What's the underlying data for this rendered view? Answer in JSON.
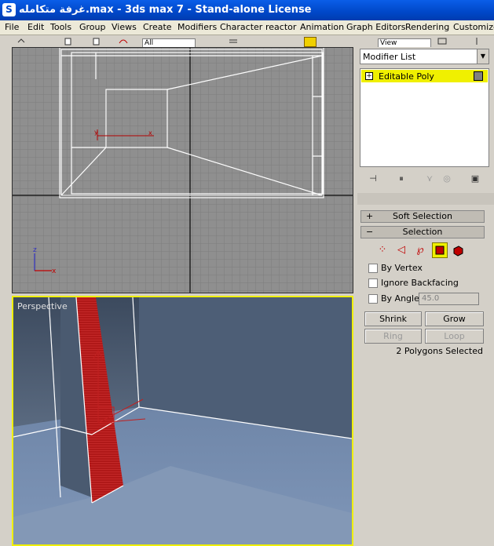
{
  "window": {
    "title": "غرفة متكامله.max - 3ds max 7  - Stand-alone License",
    "app_icon_glyph": "S"
  },
  "menu": [
    "File",
    "Edit",
    "Tools",
    "Group",
    "Views",
    "Create",
    "Modifiers",
    "Character",
    "reactor",
    "Animation",
    "Graph Editors",
    "Rendering",
    "Customize"
  ],
  "toolbar": {
    "selection_filter": "All",
    "view_combo": "View"
  },
  "viewports": {
    "top_axis_x": "x",
    "top_axis_z": "z",
    "perspective_label": "Perspective"
  },
  "command_panel": {
    "modifier_list": "Modifier List",
    "stack_item": "Editable Poly",
    "soft_selection": {
      "label": "Soft Selection",
      "toggle": "+"
    },
    "selection": {
      "label": "Selection",
      "toggle": "−",
      "by_vertex": "By Vertex",
      "ignore_backfacing": "Ignore Backfacing",
      "by_angle": "By Angle:",
      "angle_value": "45.0",
      "shrink": "Shrink",
      "grow": "Grow",
      "ring": "Ring",
      "loop": "Loop",
      "status": "2 Polygons Selected"
    }
  },
  "colors": {
    "active_viewport_border": "#f0f000",
    "stack_highlight": "#f0f000",
    "selected_polygon": "#c00000",
    "titlebar": "#0047c8"
  }
}
